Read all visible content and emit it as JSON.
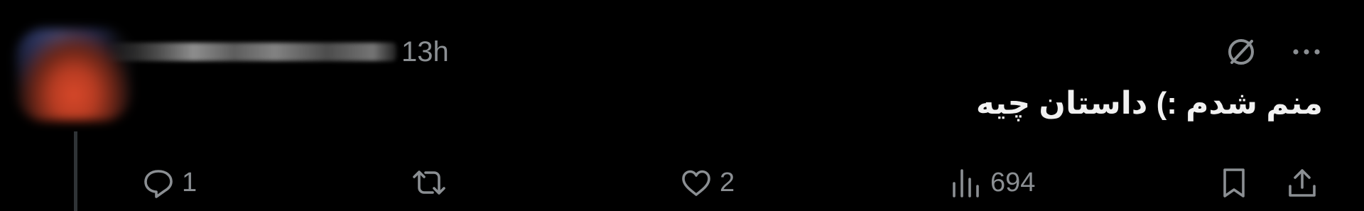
{
  "post": {
    "timestamp": "13h",
    "text": "منم شدم :) داستان چیه",
    "reply_count": "1",
    "like_count": "2",
    "view_count": "694"
  },
  "icons": {
    "top": [
      "muted-icon",
      "more-icon"
    ],
    "actions": [
      "reply-icon",
      "repost-icon",
      "like-icon",
      "views-icon",
      "bookmark-icon",
      "share-icon"
    ]
  },
  "colors": {
    "background": "#000000",
    "text": "#f1f1f1",
    "muted": "#8b8f93",
    "thread_line": "#2f3336"
  }
}
